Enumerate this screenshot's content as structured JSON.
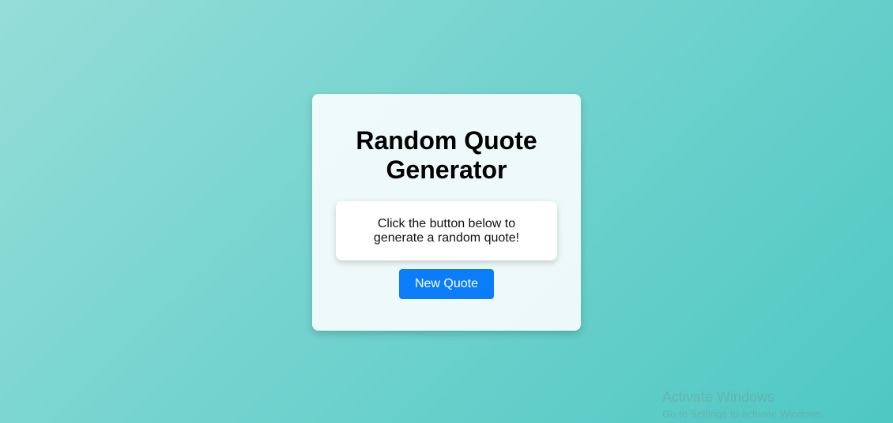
{
  "app": {
    "title": "Random Quote Generator"
  },
  "quote": {
    "text": "Click the button below to generate a random quote!"
  },
  "actions": {
    "new_quote_label": "New Quote"
  },
  "watermark": {
    "title": "Activate Windows",
    "subtitle": "Go to Settings to activate Windows."
  },
  "colors": {
    "button": "#0b7dfb",
    "background_start": "#95ddd8",
    "background_end": "#4fc8c2"
  }
}
